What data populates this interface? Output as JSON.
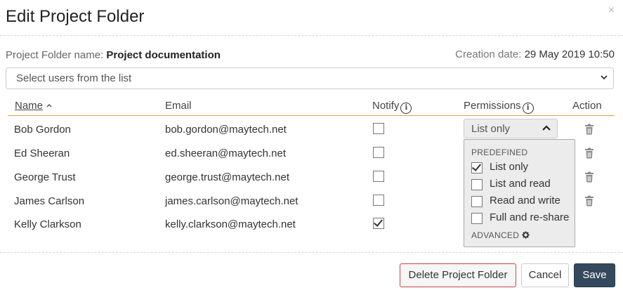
{
  "dialog": {
    "title": "Edit Project Folder",
    "close_label": "×"
  },
  "folder": {
    "name_label": "Project Folder name:",
    "name_value": "Project documentation",
    "created_label": "Creation date:",
    "created_value": "29 May 2019 10:50"
  },
  "user_select": {
    "placeholder": "Select users from the list"
  },
  "table": {
    "headers": {
      "name": "Name",
      "email": "Email",
      "notify": "Notify",
      "permissions": "Permissions",
      "action": "Action"
    },
    "rows": [
      {
        "name": "Bob Gordon",
        "email": "bob.gordon@maytech.net",
        "notify": false
      },
      {
        "name": "Ed Sheeran",
        "email": "ed.sheeran@maytech.net",
        "notify": false
      },
      {
        "name": "George Trust",
        "email": "george.trust@maytech.net",
        "notify": false
      },
      {
        "name": "James Carlson",
        "email": "james.carlson@maytech.net",
        "notify": false
      },
      {
        "name": "Kelly Clarkson",
        "email": "kelly.clarkson@maytech.net",
        "notify": true
      }
    ]
  },
  "permissions_dropdown": {
    "selected": "List only",
    "predefined_label": "PREDEFINED",
    "options": [
      {
        "label": "List only",
        "checked": true
      },
      {
        "label": "List and read",
        "checked": false
      },
      {
        "label": "Read and write",
        "checked": false
      },
      {
        "label": "Full and re-share",
        "checked": false
      }
    ],
    "advanced_label": "ADVANCED"
  },
  "buttons": {
    "delete": "Delete Project Folder",
    "cancel": "Cancel",
    "save": "Save"
  },
  "colors": {
    "save_bg": "#34495e",
    "delete_border": "#cc4444",
    "header_underline": "#d4a84a"
  }
}
